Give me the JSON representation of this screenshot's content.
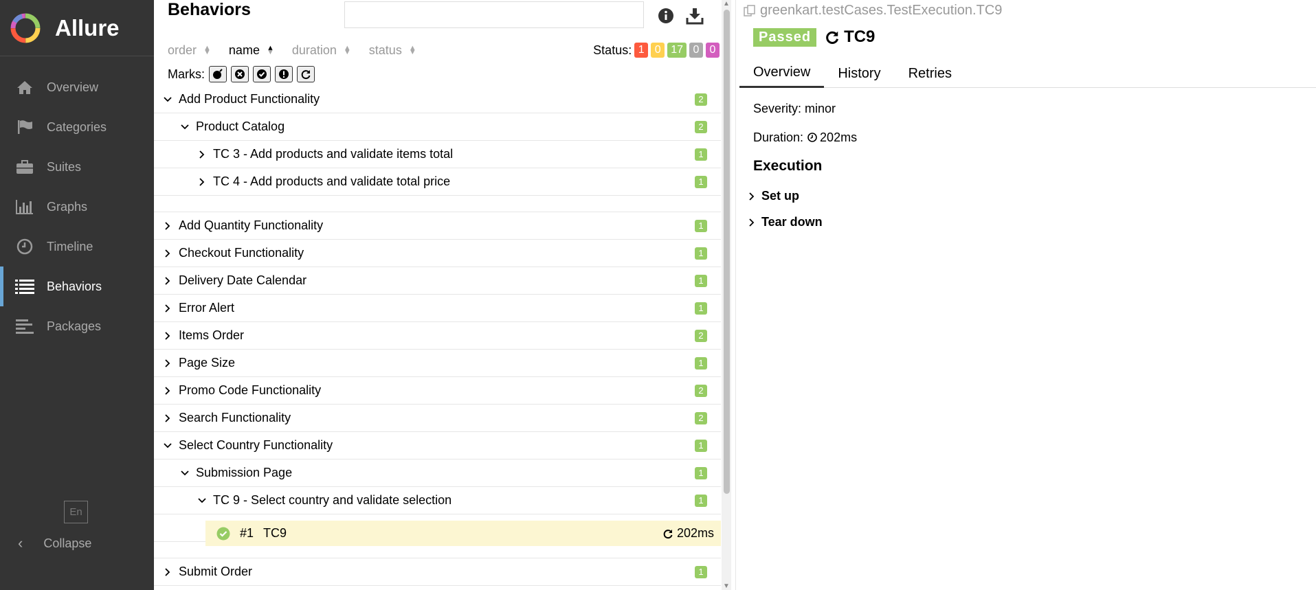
{
  "sidebar": {
    "brand": "Allure",
    "items": [
      {
        "label": "Overview",
        "icon": "home-icon"
      },
      {
        "label": "Categories",
        "icon": "flag-icon"
      },
      {
        "label": "Suites",
        "icon": "briefcase-icon"
      },
      {
        "label": "Graphs",
        "icon": "bar-chart-icon"
      },
      {
        "label": "Timeline",
        "icon": "clock-icon"
      },
      {
        "label": "Behaviors",
        "icon": "list-icon",
        "active": true
      },
      {
        "label": "Packages",
        "icon": "align-left-icon"
      }
    ],
    "language": "En",
    "collapse_label": "Collapse"
  },
  "middle": {
    "title": "Behaviors",
    "search_value": "",
    "sort": [
      "order",
      "name",
      "duration",
      "status"
    ],
    "status_label": "Status:",
    "status_counts": {
      "failed": "1",
      "broken": "0",
      "passed": "17",
      "skipped": "0",
      "unknown": "0"
    },
    "marks_label": "Marks:",
    "tree": [
      {
        "label": "Add Product Functionality",
        "count": "2",
        "expanded": true
      },
      {
        "label": "Product Catalog",
        "count": "2",
        "expanded": true
      },
      {
        "label": "TC 3 - Add products and validate items total",
        "count": "1"
      },
      {
        "label": "TC 4 - Add products and validate total price",
        "count": "1"
      },
      {
        "label": "Add Quantity Functionality",
        "count": "1"
      },
      {
        "label": "Checkout Functionality",
        "count": "1"
      },
      {
        "label": "Delivery Date Calendar",
        "count": "1"
      },
      {
        "label": "Error Alert",
        "count": "1"
      },
      {
        "label": "Items Order",
        "count": "2"
      },
      {
        "label": "Page Size",
        "count": "1"
      },
      {
        "label": "Promo Code Functionality",
        "count": "2"
      },
      {
        "label": "Search Functionality",
        "count": "2"
      },
      {
        "label": "Select Country Functionality",
        "count": "1",
        "expanded": true
      },
      {
        "label": "Submission Page",
        "count": "1",
        "expanded": true
      },
      {
        "label": "TC 9 - Select country and validate selection",
        "count": "1",
        "expanded": true
      },
      {
        "label": "Submit Order",
        "count": "1"
      }
    ],
    "leaf": {
      "order": "#1",
      "name": "TC9",
      "duration": "202ms"
    }
  },
  "detail": {
    "path": "greenkart.testCases.TestExecution.TC9",
    "status": "Passed",
    "title": "TC9",
    "tabs": [
      "Overview",
      "History",
      "Retries"
    ],
    "severity": "Severity: minor",
    "duration_label": "Duration:",
    "duration": "202ms",
    "execution_title": "Execution",
    "steps": [
      "Set up",
      "Tear down"
    ]
  },
  "colors": {
    "sidebar_bg": "#343434",
    "active_accent": "#69a6d6",
    "passed": "#97cc64",
    "failed": "#fd5a3e",
    "broken": "#ffd050",
    "skipped": "#aaaaaa",
    "unknown": "#d35ebe",
    "selected_row": "#fcf6d2"
  }
}
